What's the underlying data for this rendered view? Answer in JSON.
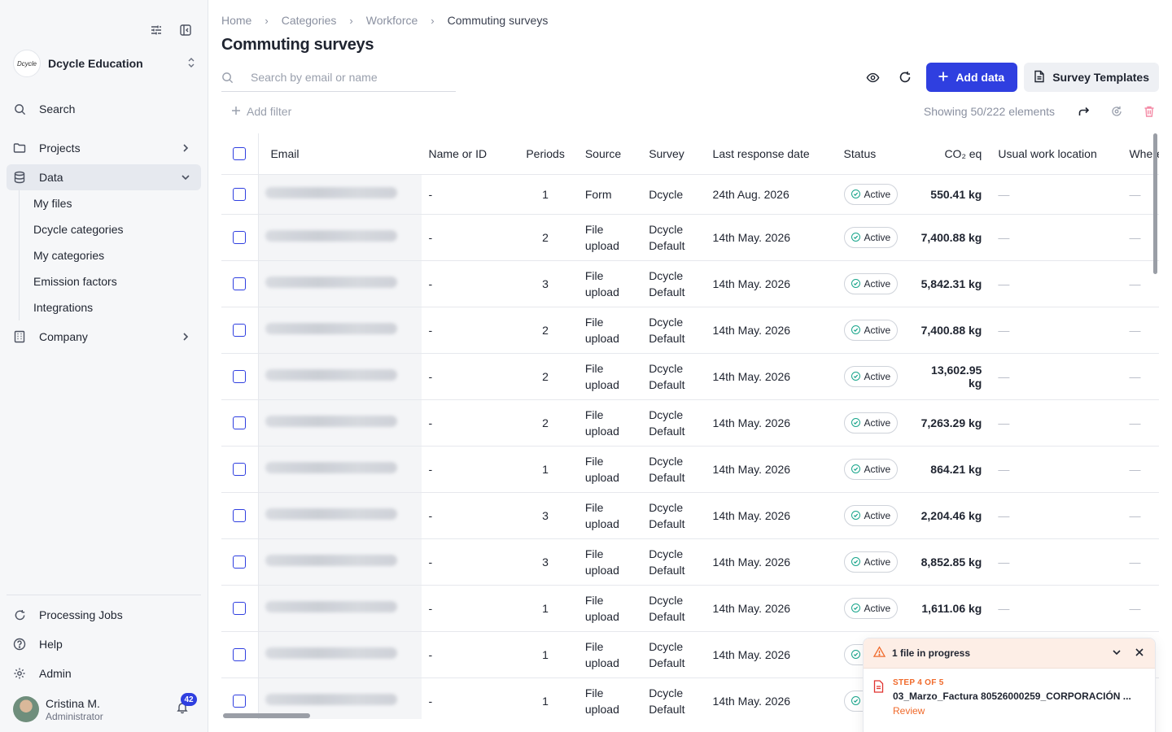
{
  "sidebar": {
    "org_logo_text": "Dcycle",
    "org_name": "Dcycle Education",
    "search_label": "Search",
    "items": [
      {
        "label": "Projects"
      },
      {
        "label": "Data"
      },
      {
        "label": "Company"
      }
    ],
    "data_subitems": [
      "My files",
      "Dcycle categories",
      "My categories",
      "Emission factors",
      "Integrations"
    ],
    "bottom_items": [
      {
        "label": "Processing Jobs"
      },
      {
        "label": "Help"
      },
      {
        "label": "Admin"
      }
    ],
    "user": {
      "name": "Cristina M.",
      "role": "Administrator",
      "notifications": "42"
    }
  },
  "header": {
    "breadcrumb": [
      "Home",
      "Categories",
      "Workforce",
      "Commuting surveys"
    ],
    "breadcrumb_separator": "›",
    "title": "Commuting surveys"
  },
  "search": {
    "placeholder": "Search by email or name",
    "value": ""
  },
  "toolbar": {
    "add_data_label": "Add data",
    "templates_label": "Survey Templates"
  },
  "filters": {
    "add_filter_label": "Add filter",
    "showing_text": "Showing 50/222 elements"
  },
  "table": {
    "columns": [
      "Email",
      "Name or ID",
      "Periods",
      "Source",
      "Survey",
      "Last response date",
      "Status",
      "CO₂ eq",
      "Usual work location",
      "Where you"
    ],
    "rows": [
      {
        "name": "-",
        "periods": "1",
        "source": "Form",
        "survey": "Dcycle",
        "date": "24th Aug. 2026",
        "status": "Active",
        "co2": "550.41 kg",
        "location": "—",
        "where": "—"
      },
      {
        "name": "-",
        "periods": "2",
        "source": "File upload",
        "survey": "Dcycle Default",
        "date": "14th May. 2026",
        "status": "Active",
        "co2": "7,400.88 kg",
        "location": "—",
        "where": "—"
      },
      {
        "name": "-",
        "periods": "3",
        "source": "File upload",
        "survey": "Dcycle Default",
        "date": "14th May. 2026",
        "status": "Active",
        "co2": "5,842.31 kg",
        "location": "—",
        "where": "—"
      },
      {
        "name": "-",
        "periods": "2",
        "source": "File upload",
        "survey": "Dcycle Default",
        "date": "14th May. 2026",
        "status": "Active",
        "co2": "7,400.88 kg",
        "location": "—",
        "where": "—"
      },
      {
        "name": "-",
        "periods": "2",
        "source": "File upload",
        "survey": "Dcycle Default",
        "date": "14th May. 2026",
        "status": "Active",
        "co2": "13,602.95 kg",
        "location": "—",
        "where": "—"
      },
      {
        "name": "-",
        "periods": "2",
        "source": "File upload",
        "survey": "Dcycle Default",
        "date": "14th May. 2026",
        "status": "Active",
        "co2": "7,263.29 kg",
        "location": "—",
        "where": "—"
      },
      {
        "name": "-",
        "periods": "1",
        "source": "File upload",
        "survey": "Dcycle Default",
        "date": "14th May. 2026",
        "status": "Active",
        "co2": "864.21 kg",
        "location": "—",
        "where": "—"
      },
      {
        "name": "-",
        "periods": "3",
        "source": "File upload",
        "survey": "Dcycle Default",
        "date": "14th May. 2026",
        "status": "Active",
        "co2": "2,204.46 kg",
        "location": "—",
        "where": "—"
      },
      {
        "name": "-",
        "periods": "3",
        "source": "File upload",
        "survey": "Dcycle Default",
        "date": "14th May. 2026",
        "status": "Active",
        "co2": "8,852.85 kg",
        "location": "—",
        "where": "—"
      },
      {
        "name": "-",
        "periods": "1",
        "source": "File upload",
        "survey": "Dcycle Default",
        "date": "14th May. 2026",
        "status": "Active",
        "co2": "1,611.06 kg",
        "location": "—",
        "where": "—"
      },
      {
        "name": "-",
        "periods": "1",
        "source": "File upload",
        "survey": "Dcycle Default",
        "date": "14th May. 2026",
        "status": "Active",
        "co2": "",
        "location": "",
        "where": ""
      },
      {
        "name": "-",
        "periods": "1",
        "source": "File upload",
        "survey": "Dcycle Default",
        "date": "14th May. 2026",
        "status": "Active",
        "co2": "",
        "location": "",
        "where": ""
      }
    ]
  },
  "toast": {
    "title": "1 file in progress",
    "step": "STEP 4 OF 5",
    "filename": "03_Marzo_Factura 80526000259_CORPORACIÓN ...",
    "action": "Review"
  },
  "colors": {
    "primary": "#2f3fe0",
    "status_active": "#18a58b",
    "warning": "#f06a2b",
    "delete": "#f48aa5"
  }
}
